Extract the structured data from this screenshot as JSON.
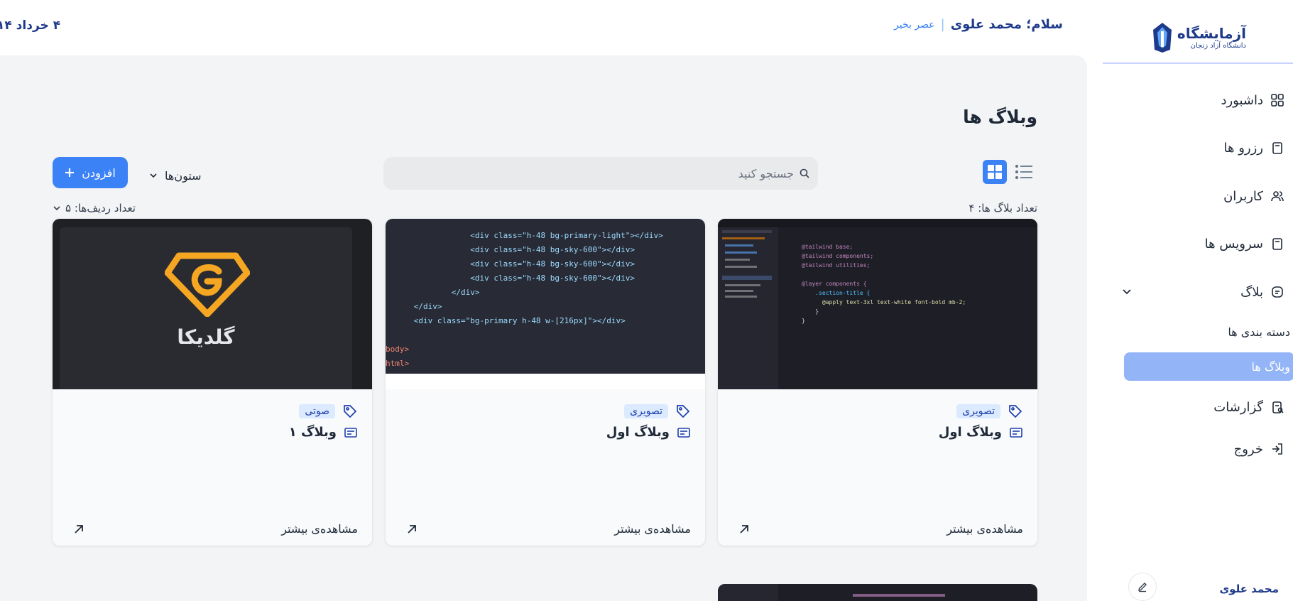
{
  "sidebar": {
    "logo_title": "آزمایشگاه",
    "logo_subtitle": "دانشگاه آزاد زنجان",
    "items": [
      {
        "label": "داشبورد",
        "icon": "dashboard-icon"
      },
      {
        "label": "رزرو ها",
        "icon": "clipboard-icon"
      },
      {
        "label": "کاربران",
        "icon": "users-icon"
      },
      {
        "label": "سرویس ها",
        "icon": "clipboard-icon"
      },
      {
        "label": "بلاگ",
        "icon": "blog-icon"
      },
      {
        "label": "گزارشات",
        "icon": "report-icon"
      },
      {
        "label": "خروج",
        "icon": "logout-icon"
      }
    ],
    "blog_sub": [
      {
        "label": "دسته بندی ها"
      },
      {
        "label": "وبلاگ ها"
      }
    ],
    "profile_name": "محمد علوی"
  },
  "header": {
    "greeting": "سلام؛ محمد علوی",
    "separator": "|",
    "time_of_day": "عصر بخیر",
    "date": "۴ خرداد ۱۴"
  },
  "main": {
    "title": "وبلاگ ها",
    "search_placeholder": "جستجو کنید",
    "columns_label": "ستون‌ها",
    "add_label": "افزودن",
    "count_label": "تعداد بلاگ ها: ۴",
    "rows_label": "تعداد ردیف‌ها: ۵"
  },
  "cards": [
    {
      "tag": "تصویری",
      "title": "وبلاگ اول",
      "more": "مشاهده‌ی بیشتر"
    },
    {
      "tag": "تصویری",
      "title": "وبلاگ اول",
      "more": "مشاهده‌ی بیشتر"
    },
    {
      "tag": "صوتی",
      "title": "وبلاگ ۱",
      "more": "مشاهده‌ی بیشتر"
    }
  ],
  "card_images": {
    "goldika_text": "گلدیکا",
    "code_lines": [
      "<div class=\"h-48 bg-primary-light\"></div>",
      "<div class=\"h-48 bg-sky-600\"></div>",
      "<div class=\"h-48 bg-sky-600\"></div>",
      "<div class=\"h-48 bg-sky-600\"></div>",
      "</div>",
      "</div>",
      "<div class=\"bg-primary h-48 w-[216px]\"></div>",
      "body>",
      "html>"
    ],
    "css_lines": [
      "@tailwind base;",
      "@tailwind components;",
      "@tailwind utilities;",
      "@layer components {",
      ".section-title {",
      "@apply text-3xl text-white font-bold mb-2;",
      "}",
      "}"
    ]
  },
  "colors": {
    "primary": "#3b82f6",
    "navy": "#1e3a8a",
    "active_bg": "#93b4f7",
    "badge_bg": "#dbeafe"
  }
}
